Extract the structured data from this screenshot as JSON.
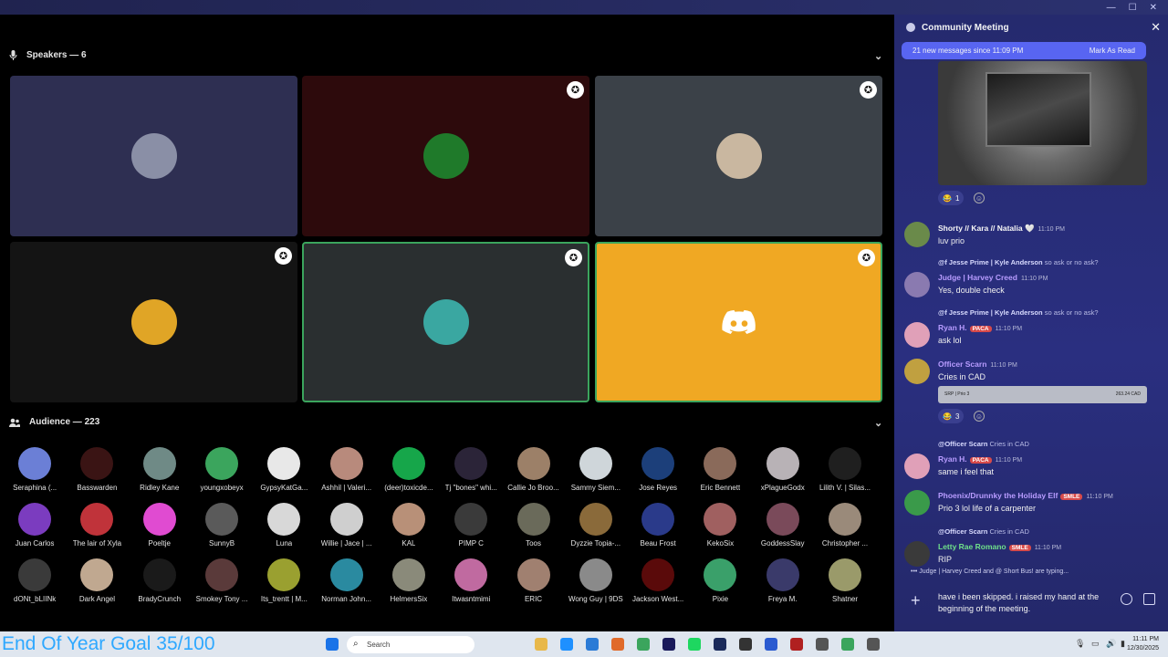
{
  "window": {
    "minimize": "—",
    "maximize": "☐",
    "close": "✕"
  },
  "speakers": {
    "header": "Speakers — 6",
    "tiles": [
      {
        "bg": "#2e2f52",
        "avatar": "#8a8fa6",
        "speaking": false,
        "badge": false
      },
      {
        "bg": "#2d0a0c",
        "avatar": "#1f7a2a",
        "speaking": false,
        "badge": true
      },
      {
        "bg": "#3b4148",
        "avatar": "#c9b7a0",
        "speaking": false,
        "badge": true
      },
      {
        "bg": "#141414",
        "avatar": "#e0a526",
        "speaking": false,
        "badge": true
      },
      {
        "bg": "#2a2f30",
        "avatar": "#3aa7a1",
        "speaking": true,
        "badge": true
      },
      {
        "bg": "#f0a823",
        "avatar": null,
        "speaking": true,
        "badge": true,
        "discord": true
      }
    ]
  },
  "audience": {
    "header": "Audience — 223",
    "members": [
      {
        "name": "Seraphina (...",
        "color": "#6b7fd6"
      },
      {
        "name": "Basswarden",
        "color": "#3a1414"
      },
      {
        "name": "Ridley Kane",
        "color": "#6f8a86"
      },
      {
        "name": "youngxobeyx",
        "color": "#3ba55d"
      },
      {
        "name": "GypsyKatGa...",
        "color": "#e8e8e8"
      },
      {
        "name": "Ashhil | Valeri...",
        "color": "#b88a7c"
      },
      {
        "name": "(deer)toxicde...",
        "color": "#16a64a"
      },
      {
        "name": "Tj \"bones\" whi...",
        "color": "#2b2438"
      },
      {
        "name": "Callie Jo Broo...",
        "color": "#9c8068"
      },
      {
        "name": "Sammy Siem...",
        "color": "#cfd6da"
      },
      {
        "name": "Jose Reyes",
        "color": "#1c3f7a"
      },
      {
        "name": "Eric Bennett",
        "color": "#8a6a5a"
      },
      {
        "name": "xPlagueGodx",
        "color": "#b8b2b6"
      },
      {
        "name": "Lilith V. | Silas...",
        "color": "#1f1f1f"
      },
      {
        "name": "Juan Carlos",
        "color": "#7b3cbf"
      },
      {
        "name": "The lair of Xyla",
        "color": "#c0333a"
      },
      {
        "name": "Poeltje",
        "color": "#e04bd1"
      },
      {
        "name": "SunnyB",
        "color": "#5a5a5a"
      },
      {
        "name": "Luna",
        "color": "#d8d8d8"
      },
      {
        "name": "Willie | Jace | ...",
        "color": "#cfcfcf"
      },
      {
        "name": "KAL",
        "color": "#b89078"
      },
      {
        "name": "PIMP C",
        "color": "#3a3a3a"
      },
      {
        "name": "Toos",
        "color": "#6a6a5a"
      },
      {
        "name": "Dyzzie Topia-...",
        "color": "#8a6a3a"
      },
      {
        "name": "Beau Frost",
        "color": "#2a3a8a"
      },
      {
        "name": "KekoSix",
        "color": "#a06060"
      },
      {
        "name": "GoddessSlay",
        "color": "#7a4a5a"
      },
      {
        "name": "Christopher ...",
        "color": "#9a8a7a"
      },
      {
        "name": "dONt_bLIINk",
        "color": "#3a3a3a"
      },
      {
        "name": "Dark Angel",
        "color": "#c0a890"
      },
      {
        "name": "BradyCrunch",
        "color": "#1a1a1a"
      },
      {
        "name": "Smokey Tony ...",
        "color": "#5a3a3a"
      },
      {
        "name": "Its_trentt | M...",
        "color": "#9aa030"
      },
      {
        "name": "Norman John...",
        "color": "#2a8aa0"
      },
      {
        "name": "HelmersSix",
        "color": "#8a8a7a"
      },
      {
        "name": "Itwasntmimi",
        "color": "#c06aa0"
      },
      {
        "name": "ERIC",
        "color": "#a08070"
      },
      {
        "name": "Wong Guy | 9DS",
        "color": "#8a8a8a"
      },
      {
        "name": "Jackson West...",
        "color": "#5a0a0a"
      },
      {
        "name": "Pixie",
        "color": "#3aa06a"
      },
      {
        "name": "Freya M.",
        "color": "#3a3a6a"
      },
      {
        "name": "Shatner",
        "color": "#9a9a6a"
      }
    ]
  },
  "overlay_text": "End Of Year Goal 35/100",
  "chat": {
    "title": "Community Meeting",
    "new_messages": "21 new messages since 11:09 PM",
    "mark_read": "Mark As Read",
    "image_reactions": [
      {
        "emoji": "😂",
        "count": "1"
      }
    ],
    "messages": [
      {
        "name": "Shorty // Kara // Natalia 🤍",
        "name_color": "#f5f5f5",
        "time": "11:10 PM",
        "text": "luv prio",
        "avatar": "#6a8a4a"
      },
      {
        "reply": "@f Jesse Prime | Kyle Anderson",
        "reply_text": "so ask or no ask?",
        "name": "Judge | Harvey Creed",
        "name_color": "#b89cff",
        "time": "11:10 PM",
        "text": "Yes, double check",
        "avatar": "#8a7ab0"
      },
      {
        "reply": "@f Jesse Prime | Kyle Anderson",
        "reply_text": "so ask or no ask?",
        "name": "Ryan H.",
        "tag": "PACA",
        "name_color": "#b89cff",
        "time": "11:10 PM",
        "text": "ask lol",
        "avatar": "#e0a0b8"
      },
      {
        "name": "Officer Scarn",
        "name_color": "#b89cff",
        "time": "11:10 PM",
        "text": "Cries in CAD",
        "avatar": "#c0a040"
      },
      {
        "reply": "@Officer Scarn",
        "reply_text": "Cries in CAD",
        "name": "Ryan H.",
        "tag": "PACA",
        "name_color": "#b89cff",
        "time": "11:10 PM",
        "text": "same i feel that",
        "avatar": "#e0a0b8"
      },
      {
        "name": "Phoenix/Drunnky the Holiday Elf",
        "tag": "SMLE",
        "name_color": "#b89cff",
        "time": "11:10 PM",
        "text": "Prio 3 lol life of a carpenter",
        "avatar": "#3a9a4a"
      },
      {
        "reply": "@Officer Scarn",
        "reply_text": "Cries in CAD",
        "name": "Letty Rae Romano",
        "tag": "SMLE",
        "name_color": "#6fe08a",
        "time": "11:10 PM",
        "text": "RIP",
        "avatar": "#3a3a3a"
      }
    ],
    "cad_left": "SRP | Prio 3",
    "cad_right": "263.24 CAD",
    "cad_reactions": [
      {
        "emoji": "😂",
        "count": "3"
      }
    ],
    "typing": "Judge | Harvey Creed and @ Short Bus! are typing...",
    "composer_text": "have i been skipped. i raised my hand at the beginning of the meeting."
  },
  "taskbar": {
    "search_placeholder": "Search",
    "time": "11:11 PM",
    "date": "12/30/2025"
  }
}
